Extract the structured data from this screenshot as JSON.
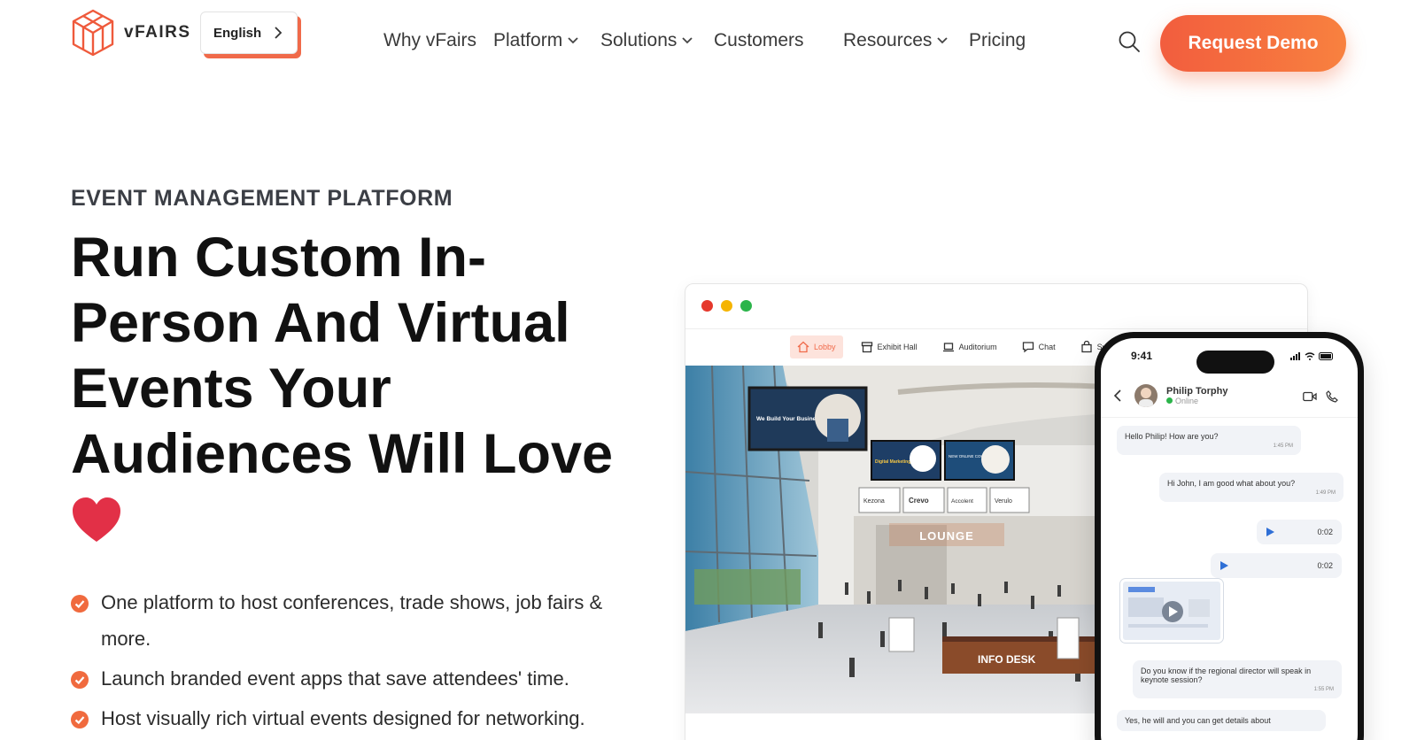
{
  "brand": {
    "name": "vFAIRS",
    "accent": "#f25d3e"
  },
  "language": {
    "label": "English"
  },
  "nav": [
    {
      "label": "Why vFairs",
      "dropdown": false
    },
    {
      "label": "Platform",
      "dropdown": true
    },
    {
      "label": "Solutions",
      "dropdown": true
    },
    {
      "label": "Customers",
      "dropdown": false
    },
    {
      "label": "Resources",
      "dropdown": true
    },
    {
      "label": "Pricing",
      "dropdown": false
    }
  ],
  "header": {
    "search_icon": "search-icon",
    "cta_label": "Request Demo"
  },
  "hero": {
    "eyebrow": "EVENT MANAGEMENT PLATFORM",
    "headline": "Run Custom In-Person And Virtual Events Your Audiences Will Love",
    "bullets": [
      "One platform to host conferences, trade shows, job fairs & more.",
      "Launch branded event apps that save attendees' time.",
      "Host visually rich virtual events designed for networking."
    ]
  },
  "mockup": {
    "window_dot_colors": [
      "#e5382c",
      "#f5b400",
      "#2bb44a"
    ],
    "venue_nav": [
      "Lobby",
      "Exhibit Hall",
      "Auditorium",
      "Chat",
      "Swag"
    ],
    "scene_labels": {
      "lounge": "LOUNGE",
      "info_desk": "INFO DESK"
    },
    "screen_text": {
      "billboard": "We Build Your Business",
      "digital": "Digital Marketing",
      "course": "NEW ONLINE COURSES"
    },
    "sponsors": [
      "Kezona",
      "Crevo",
      "Accolent",
      "Verulo"
    ]
  },
  "phone": {
    "time": "9:41",
    "contact": "Philip Torphy",
    "status": "Online",
    "messages": [
      {
        "text": "Hello Philip! How are you?",
        "time": "1:45 PM"
      },
      {
        "text": "Hi John, I am good what about you?",
        "time": "1:49 PM"
      },
      {
        "text": "Do you know if the regional director will speak in keynote session?",
        "time": "1:55 PM"
      },
      {
        "text": "Yes, he will and you can get details about"
      }
    ],
    "audio": [
      "0:02",
      "0:02"
    ]
  }
}
